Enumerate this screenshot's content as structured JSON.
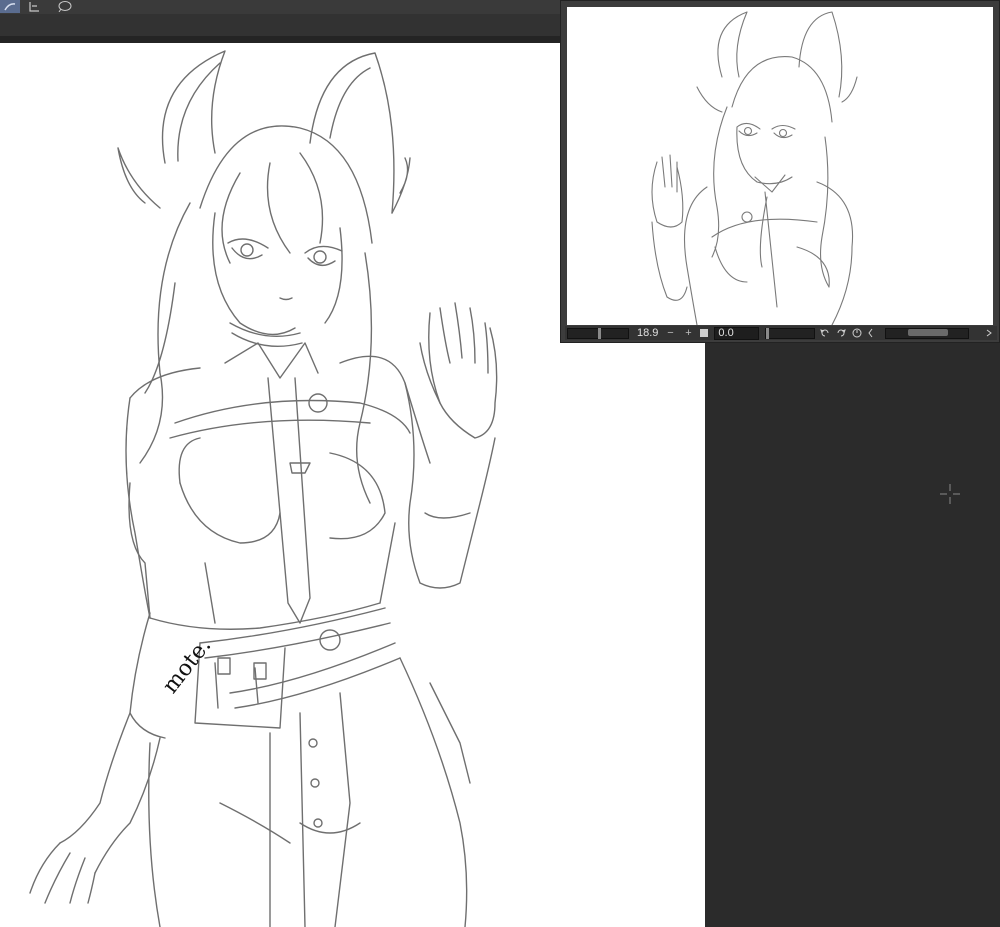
{
  "toolbar": {
    "tools": [
      {
        "icon": "brush-tool-icon"
      },
      {
        "icon": "layer-property-icon"
      },
      {
        "icon": "speech-bubble-icon"
      }
    ]
  },
  "navigator": {
    "zoom_value": "18.9",
    "rotate_value": "0.0",
    "zoom_out_label": "−",
    "zoom_in_label": "+",
    "icons": [
      "fit-icon",
      "rotate-left-icon",
      "rotate-right-icon",
      "reset-rotation-icon",
      "flip-icon"
    ]
  },
  "canvas": {
    "signature": "mote."
  },
  "colors": {
    "panel_bg": "#3c3c3c",
    "workspace_bg": "#2b2b2b",
    "active_tool": "#5a6c8f",
    "canvas_bg": "#ffffff",
    "sketch_line": "#6f6f6f"
  }
}
